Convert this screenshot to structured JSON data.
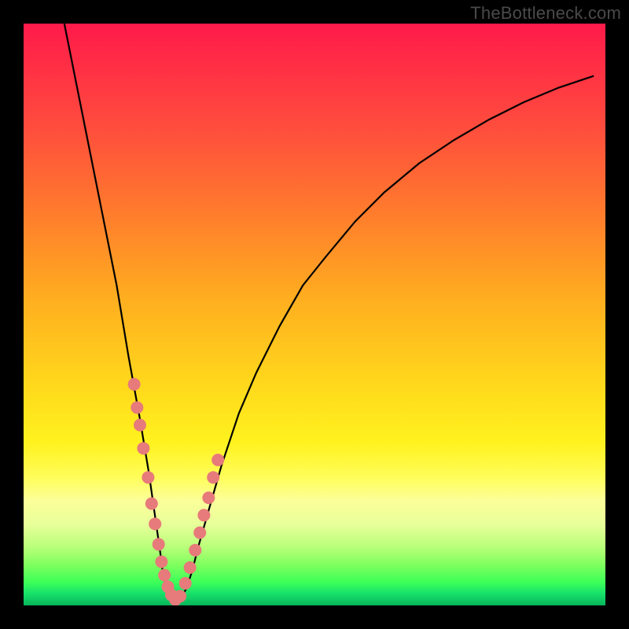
{
  "watermark": "TheBottleneck.com",
  "chart_data": {
    "type": "line",
    "title": "",
    "xlabel": "",
    "ylabel": "",
    "xlim": [
      0,
      100
    ],
    "ylim": [
      0,
      100
    ],
    "series": [
      {
        "name": "curve",
        "x": [
          7,
          10,
          13,
          16,
          18,
          20,
          21.5,
          22.5,
          23.5,
          24,
          25,
          26,
          27,
          28,
          29,
          30,
          32,
          34,
          37,
          40,
          44,
          48,
          52,
          57,
          62,
          68,
          74,
          80,
          86,
          92,
          98
        ],
        "y": [
          100,
          85,
          70,
          55,
          43,
          32,
          23,
          16,
          9,
          5,
          2,
          0.5,
          1,
          3,
          6,
          10,
          17,
          24,
          33,
          40,
          48,
          55,
          60,
          66,
          71,
          76,
          80,
          83.5,
          86.5,
          89,
          91
        ],
        "color": "#000000",
        "width": 2.2
      }
    ],
    "markers": {
      "name": "dots",
      "color": "#e77a7a",
      "radius": 8,
      "points": [
        {
          "x": 19.0,
          "y": 38
        },
        {
          "x": 19.5,
          "y": 34
        },
        {
          "x": 20.0,
          "y": 31
        },
        {
          "x": 20.6,
          "y": 27
        },
        {
          "x": 21.4,
          "y": 22
        },
        {
          "x": 22.0,
          "y": 17.5
        },
        {
          "x": 22.6,
          "y": 14
        },
        {
          "x": 23.2,
          "y": 10.5
        },
        {
          "x": 23.7,
          "y": 7.5
        },
        {
          "x": 24.2,
          "y": 5.2
        },
        {
          "x": 24.8,
          "y": 3.2
        },
        {
          "x": 25.4,
          "y": 1.8
        },
        {
          "x": 26.1,
          "y": 1.0
        },
        {
          "x": 26.9,
          "y": 1.6
        },
        {
          "x": 27.8,
          "y": 3.8
        },
        {
          "x": 28.6,
          "y": 6.5
        },
        {
          "x": 29.5,
          "y": 9.5
        },
        {
          "x": 30.3,
          "y": 12.5
        },
        {
          "x": 31.0,
          "y": 15.5
        },
        {
          "x": 31.8,
          "y": 18.5
        },
        {
          "x": 32.6,
          "y": 22
        },
        {
          "x": 33.4,
          "y": 25
        }
      ]
    }
  }
}
